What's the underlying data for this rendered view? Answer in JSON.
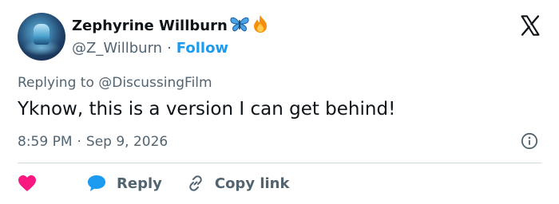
{
  "author": {
    "display_name": "Zephyrine Willburn",
    "handle": "@Z_Willburn",
    "separator": "·",
    "follow_label": "Follow"
  },
  "reply_context": "Replying to @DiscussingFilm",
  "tweet_text": "Yknow, this is a version I can get behind!",
  "timestamp": {
    "time": "8:59 PM",
    "separator": "·",
    "date": "Sep 9, 2026"
  },
  "actions": {
    "reply_label": "Reply",
    "copy_link_label": "Copy link"
  },
  "colors": {
    "accent": "#1d9bf0",
    "heart": "#f91880",
    "muted": "#536471",
    "text": "#0f1419"
  },
  "icons": [
    "butterfly-emoji-icon",
    "fire-emoji-icon",
    "x-logo-icon",
    "info-icon",
    "heart-icon",
    "reply-bubble-icon",
    "link-icon"
  ]
}
